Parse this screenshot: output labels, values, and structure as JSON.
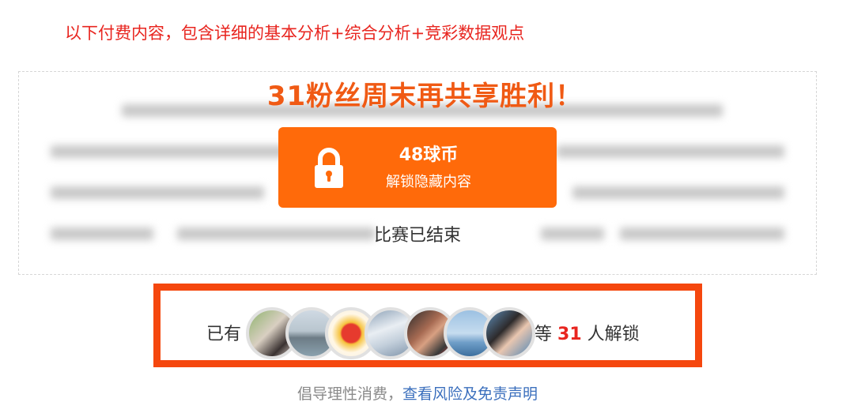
{
  "notice": "以下付费内容，包含详细的基本分析+综合分析+竞彩数据观点",
  "headline": "31粉丝周末再共享胜利！",
  "unlock_button": {
    "price": "48球币",
    "label": "解锁隐藏内容",
    "color": "#ff6a0a",
    "icon": "lock-icon"
  },
  "match_status": "比赛已结束",
  "unlockers": {
    "prefix": "已有",
    "count_before": "等",
    "count": "31",
    "count_after": "人解锁",
    "border_color": "#f5470e",
    "avatars": [
      {
        "name": "avatar-portrait-woman",
        "bg": "linear-gradient(135deg,#8fb36e 0%,#d9cfc2 45%,#3a3231 75%,#e9dcd3 100%)"
      },
      {
        "name": "avatar-ship",
        "bg": "linear-gradient(180deg,#cfd9e3 0%,#b9c6cf 45%,#6d7c86 60%,#8aa1ae 100%)"
      },
      {
        "name": "avatar-emblem",
        "bg": "radial-gradient(circle at 50% 50%,#e63a2e 0%,#e63a2e 28%,#f6c23d 34%,#fff7e6 60%,#f4ede2 100%)"
      },
      {
        "name": "avatar-clouds",
        "bg": "linear-gradient(160deg,#8fa3b8 0%,#e9eef3 40%,#c3cfdb 65%,#7e93a9 100%)"
      },
      {
        "name": "avatar-athlete",
        "bg": "linear-gradient(135deg,#2b2b2b 0%,#a66a52 40%,#d8a082 55%,#3a3a3a 80%,#e04040 100%)"
      },
      {
        "name": "avatar-seaside",
        "bg": "linear-gradient(180deg,#9cc1e2 0%,#c6dcef 50%,#6f9ec8 70%,#3d6f9e 100%)"
      },
      {
        "name": "avatar-girl-blue",
        "bg": "linear-gradient(135deg,#5e8fb9 0%,#2d2a2b 40%,#e9c6b0 60%,#4f86b5 100%)"
      }
    ]
  },
  "footer": {
    "text": "倡导理性消费，",
    "link": "查看风险及免责声明"
  }
}
